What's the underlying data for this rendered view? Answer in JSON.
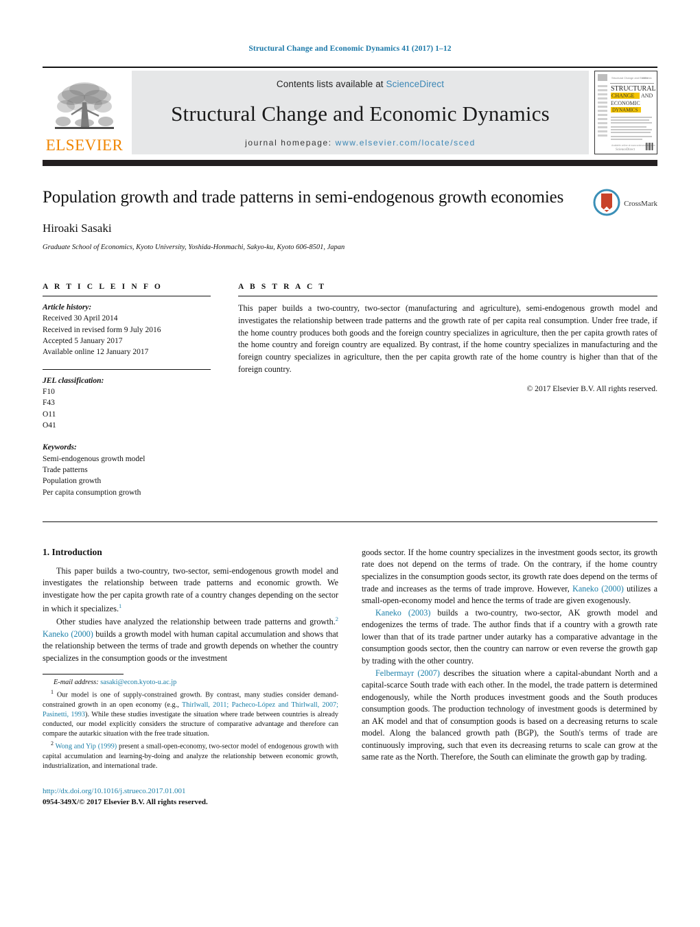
{
  "running_head": "Structural Change and Economic Dynamics 41 (2017) 1–12",
  "masthead": {
    "contents_prefix": "Contents lists available at ",
    "contents_link": "ScienceDirect",
    "journal_title": "Structural Change and Economic Dynamics",
    "homepage_label": "journal homepage:",
    "homepage_url": "www.elsevier.com/locate/sced",
    "publisher_wordmark": "ELSEVIER",
    "publisher_logo_icon": "elsevier-tree-icon",
    "cover_thumb_icon": "journal-cover-thumbnail",
    "cover_title_lines": [
      "STRUCTURAL",
      "CHANGE AND",
      "ECONOMIC",
      "DYNAMICS"
    ],
    "accent_orange": "#f08500",
    "link_blue": "#3a86b5",
    "band_gray": "#e6e7e8",
    "dark_bar": "#231f20"
  },
  "article": {
    "title": "Population growth and trade patterns in semi-endogenous growth economies",
    "author": "Hiroaki Sasaki",
    "affiliation": "Graduate School of Economics, Kyoto University, Yoshida-Honmachi, Sakyo-ku, Kyoto 606-8501, Japan",
    "crossmark_label": "CrossMark",
    "crossmark_icon": "crossmark-logo-icon"
  },
  "article_info": {
    "heading": "A R T I C L E   I N F O",
    "history_label": "Article history:",
    "history": [
      "Received 30 April 2014",
      "Received in revised form 9 July 2016",
      "Accepted 5 January 2017",
      "Available online 12 January 2017"
    ],
    "jel_label": "JEL classification:",
    "jel_codes": [
      "F10",
      "F43",
      "O11",
      "O41"
    ],
    "keywords_label": "Keywords:",
    "keywords": [
      "Semi-endogenous growth model",
      "Trade patterns",
      "Population growth",
      "Per capita consumption growth"
    ]
  },
  "abstract": {
    "heading": "A B S T R A C T",
    "text": "This paper builds a two-country, two-sector (manufacturing and agriculture), semi-endogenous growth model and investigates the relationship between trade patterns and the growth rate of per capita real consumption. Under free trade, if the home country produces both goods and the foreign country specializes in agriculture, then the per capita growth rates of the home country and foreign country are equalized. By contrast, if the home country specializes in manufacturing and the foreign country specializes in agriculture, then the per capita growth rate of the home country is higher than that of the foreign country.",
    "copyright": "© 2017 Elsevier B.V. All rights reserved."
  },
  "body": {
    "section_number_title": "1.  Introduction",
    "left_paragraphs": [
      {
        "segments": [
          {
            "t": "This paper builds a two-country, two-sector, semi-endogenous growth model and investigates the relationship between trade patterns and economic growth. We investigate how the per capita growth rate of a country changes depending on the sector in which it specializes.",
            "k": "plain"
          },
          {
            "t": "1",
            "k": "sup"
          }
        ]
      },
      {
        "segments": [
          {
            "t": "Other studies have analyzed the relationship between trade patterns and growth.",
            "k": "plain"
          },
          {
            "t": "2",
            "k": "sup"
          },
          {
            "t": " ",
            "k": "plain"
          },
          {
            "t": "Kaneko (2000)",
            "k": "cite"
          },
          {
            "t": " builds a growth model with human capital accumulation and shows that the relationship between the terms of trade and growth depends on whether the country specializes in the consumption goods or the investment",
            "k": "plain"
          }
        ]
      }
    ],
    "right_paragraphs": [
      {
        "segments": [
          {
            "t": "goods sector. If the home country specializes in the investment goods sector, its growth rate does not depend on the terms of trade. On the contrary, if the home country specializes in the consumption goods sector, its growth rate does depend on the terms of trade and increases as the terms of trade improve. However, ",
            "k": "plain"
          },
          {
            "t": "Kaneko (2000)",
            "k": "cite"
          },
          {
            "t": " utilizes a small-open-economy model and hence the terms of trade are given exogenously.",
            "k": "plain"
          }
        ]
      },
      {
        "segments": [
          {
            "t": "Kaneko (2003)",
            "k": "cite"
          },
          {
            "t": " builds a two-country, two-sector, AK growth model and endogenizes the terms of trade. The author finds that if a country with a growth rate lower than that of its trade partner under autarky has a comparative advantage in the consumption goods sector, then the country can narrow or even reverse the growth gap by trading with the other country.",
            "k": "plain"
          }
        ]
      },
      {
        "segments": [
          {
            "t": "Felbermayr (2007)",
            "k": "cite"
          },
          {
            "t": " describes the situation where a capital-abundant North and a capital-scarce South trade with each other. In the model, the trade pattern is determined endogenously, while the North produces investment goods and the South produces consumption goods. The production technology of investment goods is determined by an AK model and that of consumption goods is based on a decreasing returns to scale model. Along the balanced growth path (BGP), the South's terms of trade are continuously improving, such that even its decreasing returns to scale can grow at the same rate as the North. Therefore, the South can eliminate the growth gap by trading.",
            "k": "plain"
          }
        ]
      }
    ]
  },
  "footnotes": {
    "email_label": "E-mail address:",
    "email": "sasaki@econ.kyoto-u.ac.jp",
    "items": [
      {
        "marker": "1",
        "segments": [
          {
            "t": "Our model is one of supply-constrained growth. By contrast, many studies consider demand-constrained growth in an open economy (e.g., ",
            "k": "plain"
          },
          {
            "t": "Thirlwall, 2011; Pacheco-López and Thirlwall, 2007; Pasinetti, 1993",
            "k": "cite"
          },
          {
            "t": "). While these studies investigate the situation where trade between countries is already conducted, our model explicitly considers the structure of comparative advantage and therefore can compare the autarkic situation with the free trade situation.",
            "k": "plain"
          }
        ]
      },
      {
        "marker": "2",
        "segments": [
          {
            "t": "Wong and Yip (1999)",
            "k": "cite"
          },
          {
            "t": " present a small-open-economy, two-sector model of endogenous growth with capital accumulation and learning-by-doing and analyze the relationship between economic growth, industrialization, and international trade.",
            "k": "plain"
          }
        ]
      }
    ],
    "doi": "http://dx.doi.org/10.1016/j.strueco.2017.01.001",
    "issn_line": "0954-349X/© 2017 Elsevier B.V. All rights reserved."
  }
}
